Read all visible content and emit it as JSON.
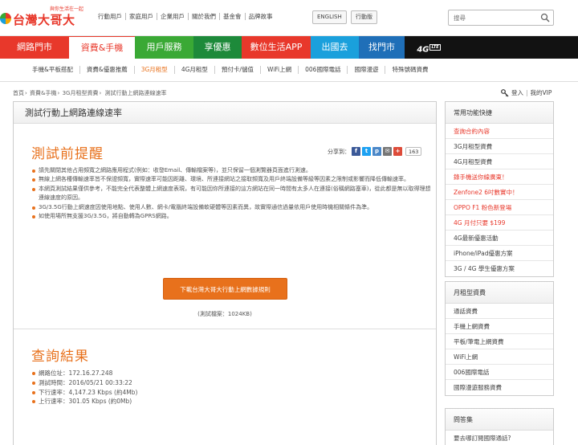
{
  "brand": {
    "slogan": "與你生活在一起",
    "name": "台灣大哥大"
  },
  "top_links": [
    "行動用戶",
    "家庭用戶",
    "企業用戶",
    "關於我們",
    "基金會",
    "品牌故事"
  ],
  "lang_buttons": [
    "ENGLISH",
    "行動版"
  ],
  "search": {
    "placeholder": "搜尋"
  },
  "main_nav": [
    {
      "label": "網路門市",
      "color": "#e8382b"
    },
    {
      "label": "資費&手機",
      "color": "#ffffff",
      "text_color": "#e8382b"
    },
    {
      "label": "用戶服務",
      "color": "#3aa935"
    },
    {
      "label": "享優惠",
      "color": "#1d8a3a"
    },
    {
      "label": "數位生活APP",
      "color": "#e8382b"
    },
    {
      "label": "出國去",
      "color": "#1aa0dc"
    },
    {
      "label": "找門市",
      "color": "#1f6fb8"
    },
    {
      "label": "4G",
      "badge": "LTE",
      "color": "#121212"
    }
  ],
  "sub_nav": [
    "手機&平板搭配",
    "資費&優惠推薦",
    "3G月租型",
    "4G月租型",
    "預付卡/儲值",
    "WiFi上網",
    "006國際電話",
    "國際漫遊",
    "特殊號碼資費"
  ],
  "sub_nav_active": "3G月租型",
  "breadcrumb": [
    "首頁",
    "資費&手機",
    "3G月租型資費",
    "測試行動上網路連線速率"
  ],
  "user_links": {
    "login": "登入",
    "my_vip": "我的VIP"
  },
  "panel": {
    "title": "測試行動上網路連線速率",
    "reminder_title": "測試前提醒",
    "share_label": "分享到：",
    "share_count": "163",
    "tips": [
      "請先關閉其他占用頻寬之網路應用程式(例如：收發Email、傳輸檔案等)，並只保留一個測覽器頁面進行測速。",
      "無線上網各種傳輸速率皆不保證頻寬，實際速率可能因距離、環境、所連接網站之接取頻寬及用戶終端設備等級等因素之限制或影響而降低傳輸速率。",
      "本網頁測試結果僅供參考，不能完全代表整體上網速度表現，有可能因你所連接的這方網站在同一時間有太多人在連接(俗稱網路塞車)，從此都是無以取得理想連線速度的原因。",
      "3G/3.5G行動上網速度因使用地點、使用人數、網卡/電腦終端設備軟硬體等因素而異，故實際通信過量依用戶使用時機相關條件為準。",
      "如使用場所無支援3G/3.5G，將自動轉為GPRS網路。"
    ],
    "download_button": "下載台灣大哥大行動上網數據規則",
    "file_size": "(測試檔案：1024KB)",
    "results_title": "查詢結果",
    "results": [
      "網路位址：172.16.27.248",
      "測試時間：2016/05/21 00:33:22",
      "下行速率：4,147.23 Kbps (約4Mb)",
      "上行速率：301.05 Kbps (約0Mb)"
    ]
  },
  "sidebar": {
    "quick_title": "常用功能快捷",
    "quick_items": [
      {
        "label": "查詢合約內容",
        "highlight": true
      },
      {
        "label": "3G月租型資費",
        "highlight": false
      },
      {
        "label": "4G月租型資費",
        "highlight": false
      },
      {
        "label": "錄手機送你線廣東！",
        "highlight": true
      },
      {
        "label": "Zenfone2 6吋數實中！",
        "highlight": true
      },
      {
        "label": "OPPO F1 粉色新登場",
        "highlight": true
      },
      {
        "label": "4G 月付只要 $199",
        "highlight": true
      },
      {
        "label": "4G最新優惠活動",
        "highlight": false
      },
      {
        "label": "iPhone/iPad優惠方案",
        "highlight": false
      },
      {
        "label": "3G / 4G 學生優惠方案",
        "highlight": false
      }
    ],
    "rate_title": "月租型資費",
    "rate_items": [
      "通話資費",
      "手機上網資費",
      "平板/筆電上網資費",
      "WiFi上網",
      "006國際電話",
      "國際漫遊服務資費"
    ],
    "faq_title": "問答集",
    "faq_items": [
      "要去哪訂閱國際通話?"
    ]
  }
}
